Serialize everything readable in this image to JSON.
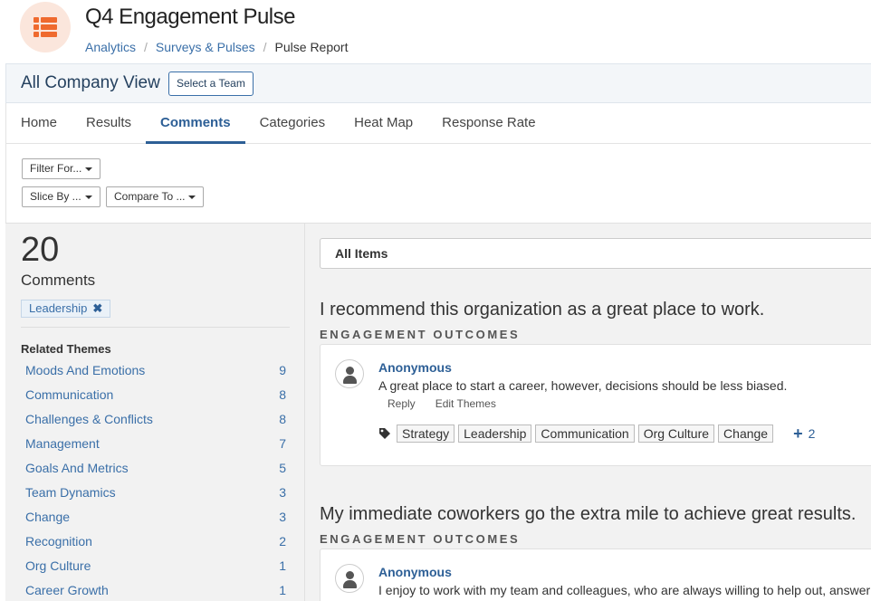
{
  "header": {
    "title": "Q4 Engagement Pulse",
    "breadcrumb": [
      "Analytics",
      "Surveys & Pulses",
      "Pulse Report"
    ]
  },
  "company_bar": {
    "title": "All Company View",
    "select_team_label": "Select a Team"
  },
  "tabs": [
    "Home",
    "Results",
    "Comments",
    "Categories",
    "Heat Map",
    "Response Rate"
  ],
  "active_tab": "Comments",
  "filters": {
    "filter_for": "Filter For...",
    "slice_by": "Slice By ...",
    "compare_to": "Compare To ..."
  },
  "summary": {
    "count": "20",
    "label": "Comments",
    "active_filter": "Leadership",
    "themes_heading": "Related Themes",
    "themes": [
      {
        "name": "Moods And Emotions",
        "count": "9"
      },
      {
        "name": "Communication",
        "count": "8"
      },
      {
        "name": "Challenges & Conflicts",
        "count": "8"
      },
      {
        "name": "Management",
        "count": "7"
      },
      {
        "name": "Goals And Metrics",
        "count": "5"
      },
      {
        "name": "Team Dynamics",
        "count": "3"
      },
      {
        "name": "Change",
        "count": "3"
      },
      {
        "name": "Recognition",
        "count": "2"
      },
      {
        "name": "Org Culture",
        "count": "1"
      },
      {
        "name": "Career Growth",
        "count": "1"
      }
    ]
  },
  "items_filter": "All Items",
  "questions": [
    {
      "title": "I recommend this organization as a great place to work.",
      "category": "ENGAGEMENT OUTCOMES",
      "comment": {
        "author": "Anonymous",
        "text": "A great place to start a career, however, decisions should be less biased.",
        "actions": [
          "Reply",
          "Edit Themes"
        ],
        "tags": [
          "Strategy",
          "Leadership",
          "Communication",
          "Org Culture",
          "Change"
        ],
        "more_tags": "2"
      }
    },
    {
      "title": "My immediate coworkers go the extra mile to achieve great results.",
      "category": "ENGAGEMENT OUTCOMES",
      "comment": {
        "author": "Anonymous",
        "text": "I enjoy to work with my team and colleagues, who are always willing to help out, answer"
      }
    }
  ],
  "colors": {
    "accent": "#2d5f96",
    "link": "#3a6fa8",
    "logo": "#ef6a2e",
    "panel_bg": "#f2f2f2"
  },
  "icons": {
    "logo": "list-icon",
    "tag": "tag-icon",
    "avatar": "user-icon",
    "remove": "close-icon",
    "more": "plus-icon"
  }
}
